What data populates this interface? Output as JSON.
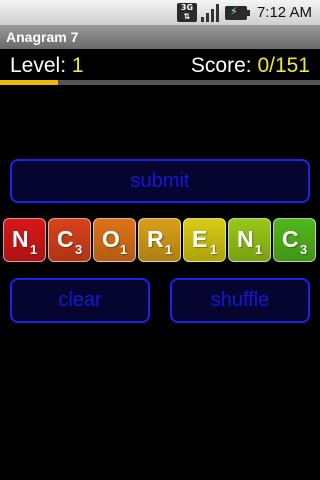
{
  "status_bar": {
    "network_label": "3G",
    "time": "7:12 AM",
    "icons": [
      "network-3g-icon",
      "signal-icon",
      "battery-charging-icon"
    ]
  },
  "app": {
    "title": "Anagram 7"
  },
  "level": {
    "label": "Level:",
    "value": "1"
  },
  "score": {
    "label": "Score:",
    "value": "0/151"
  },
  "progress": {
    "fraction": 0.18,
    "color": "#f0b800"
  },
  "buttons": {
    "submit": "submit",
    "clear": "clear",
    "shuffle": "shuffle"
  },
  "tiles": [
    {
      "letter": "N",
      "points": "1",
      "color": "#d81818"
    },
    {
      "letter": "C",
      "points": "3",
      "color": "#d9421a"
    },
    {
      "letter": "O",
      "points": "1",
      "color": "#de7418"
    },
    {
      "letter": "R",
      "points": "1",
      "color": "#d8a018"
    },
    {
      "letter": "E",
      "points": "1",
      "color": "#d8cc12"
    },
    {
      "letter": "N",
      "points": "1",
      "color": "#98c818"
    },
    {
      "letter": "C",
      "points": "3",
      "color": "#52b81c"
    }
  ],
  "colors": {
    "accent": "#f0e830",
    "button_border": "#2020ee",
    "button_text": "#1616d8"
  }
}
